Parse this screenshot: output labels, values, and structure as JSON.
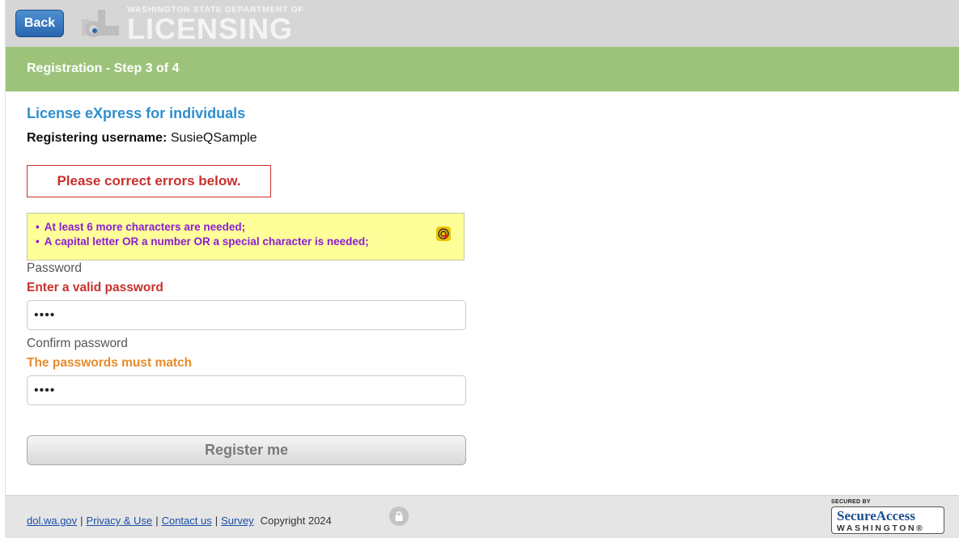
{
  "header": {
    "back_label": "Back",
    "logo_mark": "dl",
    "logo_small": "WASHINGTON STATE DEPARTMENT OF",
    "logo_big": "LICENSING"
  },
  "stepbar": {
    "label": "Registration - Step 3 of 4"
  },
  "main": {
    "title": "License eXpress for individuals",
    "username_label": "Registering username:",
    "username_value": "SusieQSample",
    "error_summary": "Please correct errors below.",
    "password_hints": [
      "At least 6 more characters are needed;",
      "A capital letter OR a number OR a special character is needed;"
    ],
    "hint_icon": "password-meter-icon",
    "password_label": "Password",
    "password_error": "Enter a valid password",
    "password_value": "••••",
    "confirm_label": "Confirm password",
    "confirm_error": "The passwords must match",
    "confirm_value": "••••",
    "register_label": "Register me"
  },
  "footer": {
    "links": [
      "dol.wa.gov",
      "Privacy & Use",
      "Contact us",
      "Survey"
    ],
    "copyright": "Copyright 2024",
    "lock_icon": "lock-icon",
    "badge_secured": "SECURED BY",
    "badge_main": "SecureAccess",
    "badge_sub": "WASHINGTON®"
  },
  "colors": {
    "header_bg": "#d6d6d6",
    "stepbar_bg": "#9dc37a",
    "title_blue": "#2e8fcf",
    "error_red": "#c9302c",
    "warning_orange": "#e58a2b",
    "hint_bg": "#ffff99",
    "hint_text": "#8a1cd6"
  }
}
